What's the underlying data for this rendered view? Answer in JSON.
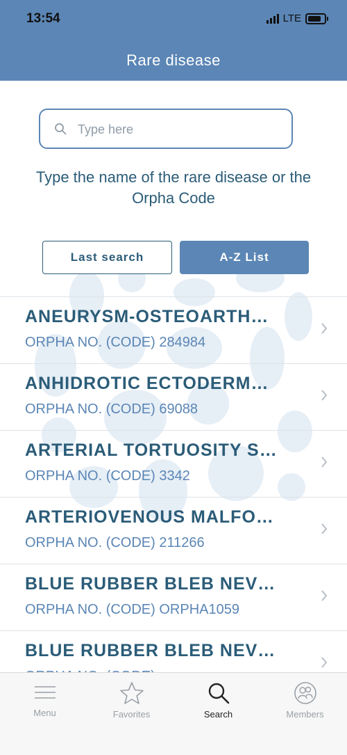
{
  "status": {
    "time": "13:54",
    "network": "LTE"
  },
  "header": {
    "title": "Rare disease"
  },
  "search": {
    "placeholder": "Type here"
  },
  "hint": "Type the name of the rare disease or the Orpha Code",
  "buttons": {
    "last_search": "Last search",
    "az_list": "A-Z List"
  },
  "list": [
    {
      "name": "ANEURYSM-OSTEOARTH…",
      "code": "ORPHA NO. (CODE) 284984"
    },
    {
      "name": "ANHIDROTIC ECTODERM…",
      "code": "ORPHA NO. (CODE) 69088"
    },
    {
      "name": "ARTERIAL TORTUOSITY S…",
      "code": "ORPHA NO. (CODE) 3342"
    },
    {
      "name": "ARTERIOVENOUS MALFO…",
      "code": "ORPHA NO. (CODE) 211266"
    },
    {
      "name": "BLUE RUBBER BLEB NEV…",
      "code": "ORPHA NO. (CODE) ORPHA1059"
    },
    {
      "name": "BLUE RUBBER BLEB NEV…",
      "code": "ORPHA NO. (CODE)"
    }
  ],
  "tabs": [
    {
      "label": "Menu",
      "icon": "menu-icon"
    },
    {
      "label": "Favorites",
      "icon": "star-icon"
    },
    {
      "label": "Search",
      "icon": "search-icon"
    },
    {
      "label": "Members",
      "icon": "members-icon"
    }
  ],
  "colors": {
    "primary": "#5b86b5",
    "text": "#2b5c78"
  }
}
